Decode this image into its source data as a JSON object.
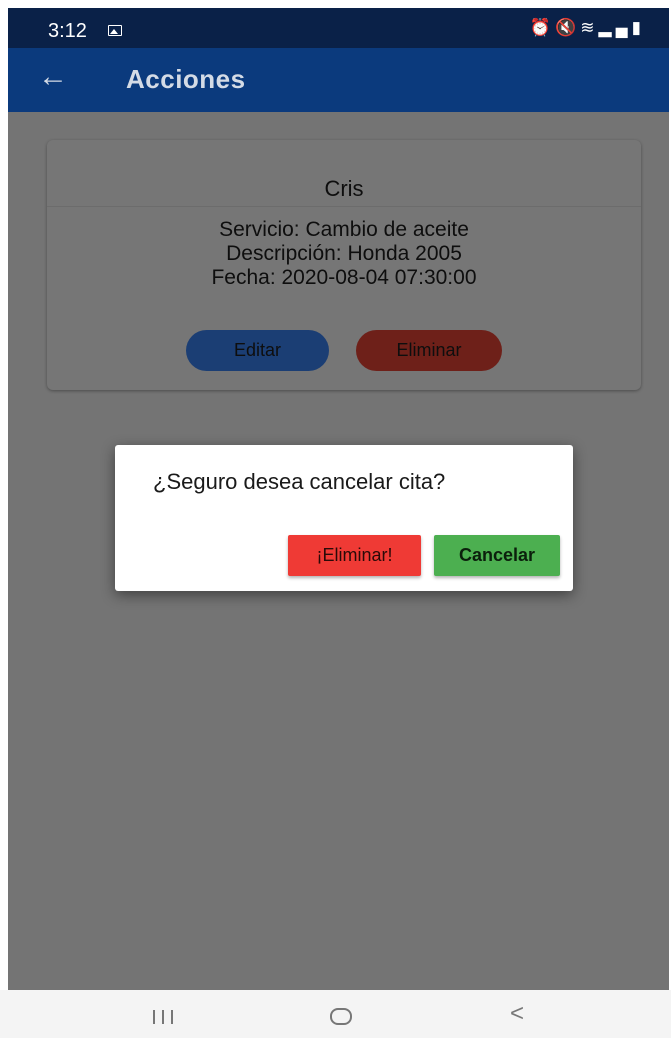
{
  "status_bar": {
    "time": "3:12",
    "icons": [
      "gallery-icon",
      "alarm-icon",
      "mute-icon",
      "wifi-icon",
      "signal-icon",
      "battery-icon"
    ]
  },
  "app_bar": {
    "title": "Acciones"
  },
  "card": {
    "title": "Cris",
    "servicio": "Servicio: Cambio de aceite",
    "descripcion": "Descripción:  Honda 2005",
    "fecha": "Fecha: 2020-08-04 07:30:00",
    "edit_label": "Editar",
    "delete_label": "Eliminar"
  },
  "dialog": {
    "message": "¿Seguro desea cancelar cita?",
    "delete_label": "¡Eliminar!",
    "cancel_label": "Cancelar"
  },
  "colors": {
    "app_bar": "#0b3a7d",
    "status_bar": "#0a2148",
    "edit_button": "#1b3e74",
    "delete_button": "#6e2019",
    "dialog_delete": "#ef3a35",
    "dialog_cancel": "#4caf50"
  }
}
